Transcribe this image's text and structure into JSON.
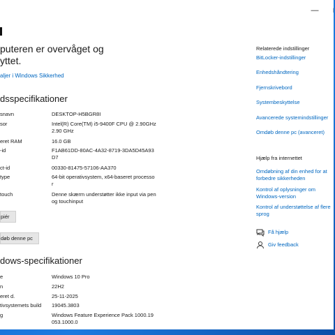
{
  "window": {
    "min_glyph": "—",
    "max_glyph": "□"
  },
  "protection": {
    "line1": "puteren er overvåget og",
    "line2": "yttet.",
    "details_link": "aljer i Windows Sikkerhed"
  },
  "device_specs": {
    "title": "dsspecifikationer",
    "rows": [
      {
        "label": "snavn",
        "value": "DESKTOP-H5BGR8I"
      },
      {
        "label": "sor",
        "value": "Intel(R) Core(TM) i5-9400F CPU @ 2.90GHz 2.90 GHz"
      },
      {
        "label": "eret RAM",
        "value": "16.0 GB"
      },
      {
        "label": "-id",
        "value": "F1AB61DD-80AC-4A32-8719-3DA5D45A93D7"
      },
      {
        "label": "ct-id",
        "value": "00330-81475-57106-AA370"
      },
      {
        "label": "type",
        "value": "64-bit operativsystem, x64-baseret processor"
      },
      {
        "label": "touch",
        "value": "Denne skærm understøtter ikke input via pen og touchinput"
      }
    ],
    "copy_button": "piér",
    "rename_button": "døb denne pc"
  },
  "windows_specs": {
    "title": "dows-specifikationer",
    "rows": [
      {
        "label": "e",
        "value": "Windows 10 Pro"
      },
      {
        "label": "n",
        "value": "22H2"
      },
      {
        "label": "eret d.",
        "value": "25-11-2025"
      },
      {
        "label": "tivsystemets build",
        "value": "19045.3803"
      },
      {
        "label": "g",
        "value": "Windows Feature Experience Pack 1000.19053.1000.0"
      }
    ]
  },
  "related": {
    "title": "Relaterede indstillinger",
    "links": [
      "BitLocker-indstillinger",
      "Enhedshåndtering",
      "Fjernskrivebord",
      "Systembeskyttelse",
      "Avancerede systemindstillinger",
      "Omdøb denne pc (avanceret)"
    ]
  },
  "help": {
    "title": "Hjælp fra internettet",
    "links": [
      "Omdøbning af din enhed for at forbedre sikkerheden",
      "Kontrol af oplysninger om Windows-version",
      "Kontrol af understøttelse af flere sprog"
    ],
    "get_help": "Få hjælp",
    "feedback": "Giv feedback"
  }
}
